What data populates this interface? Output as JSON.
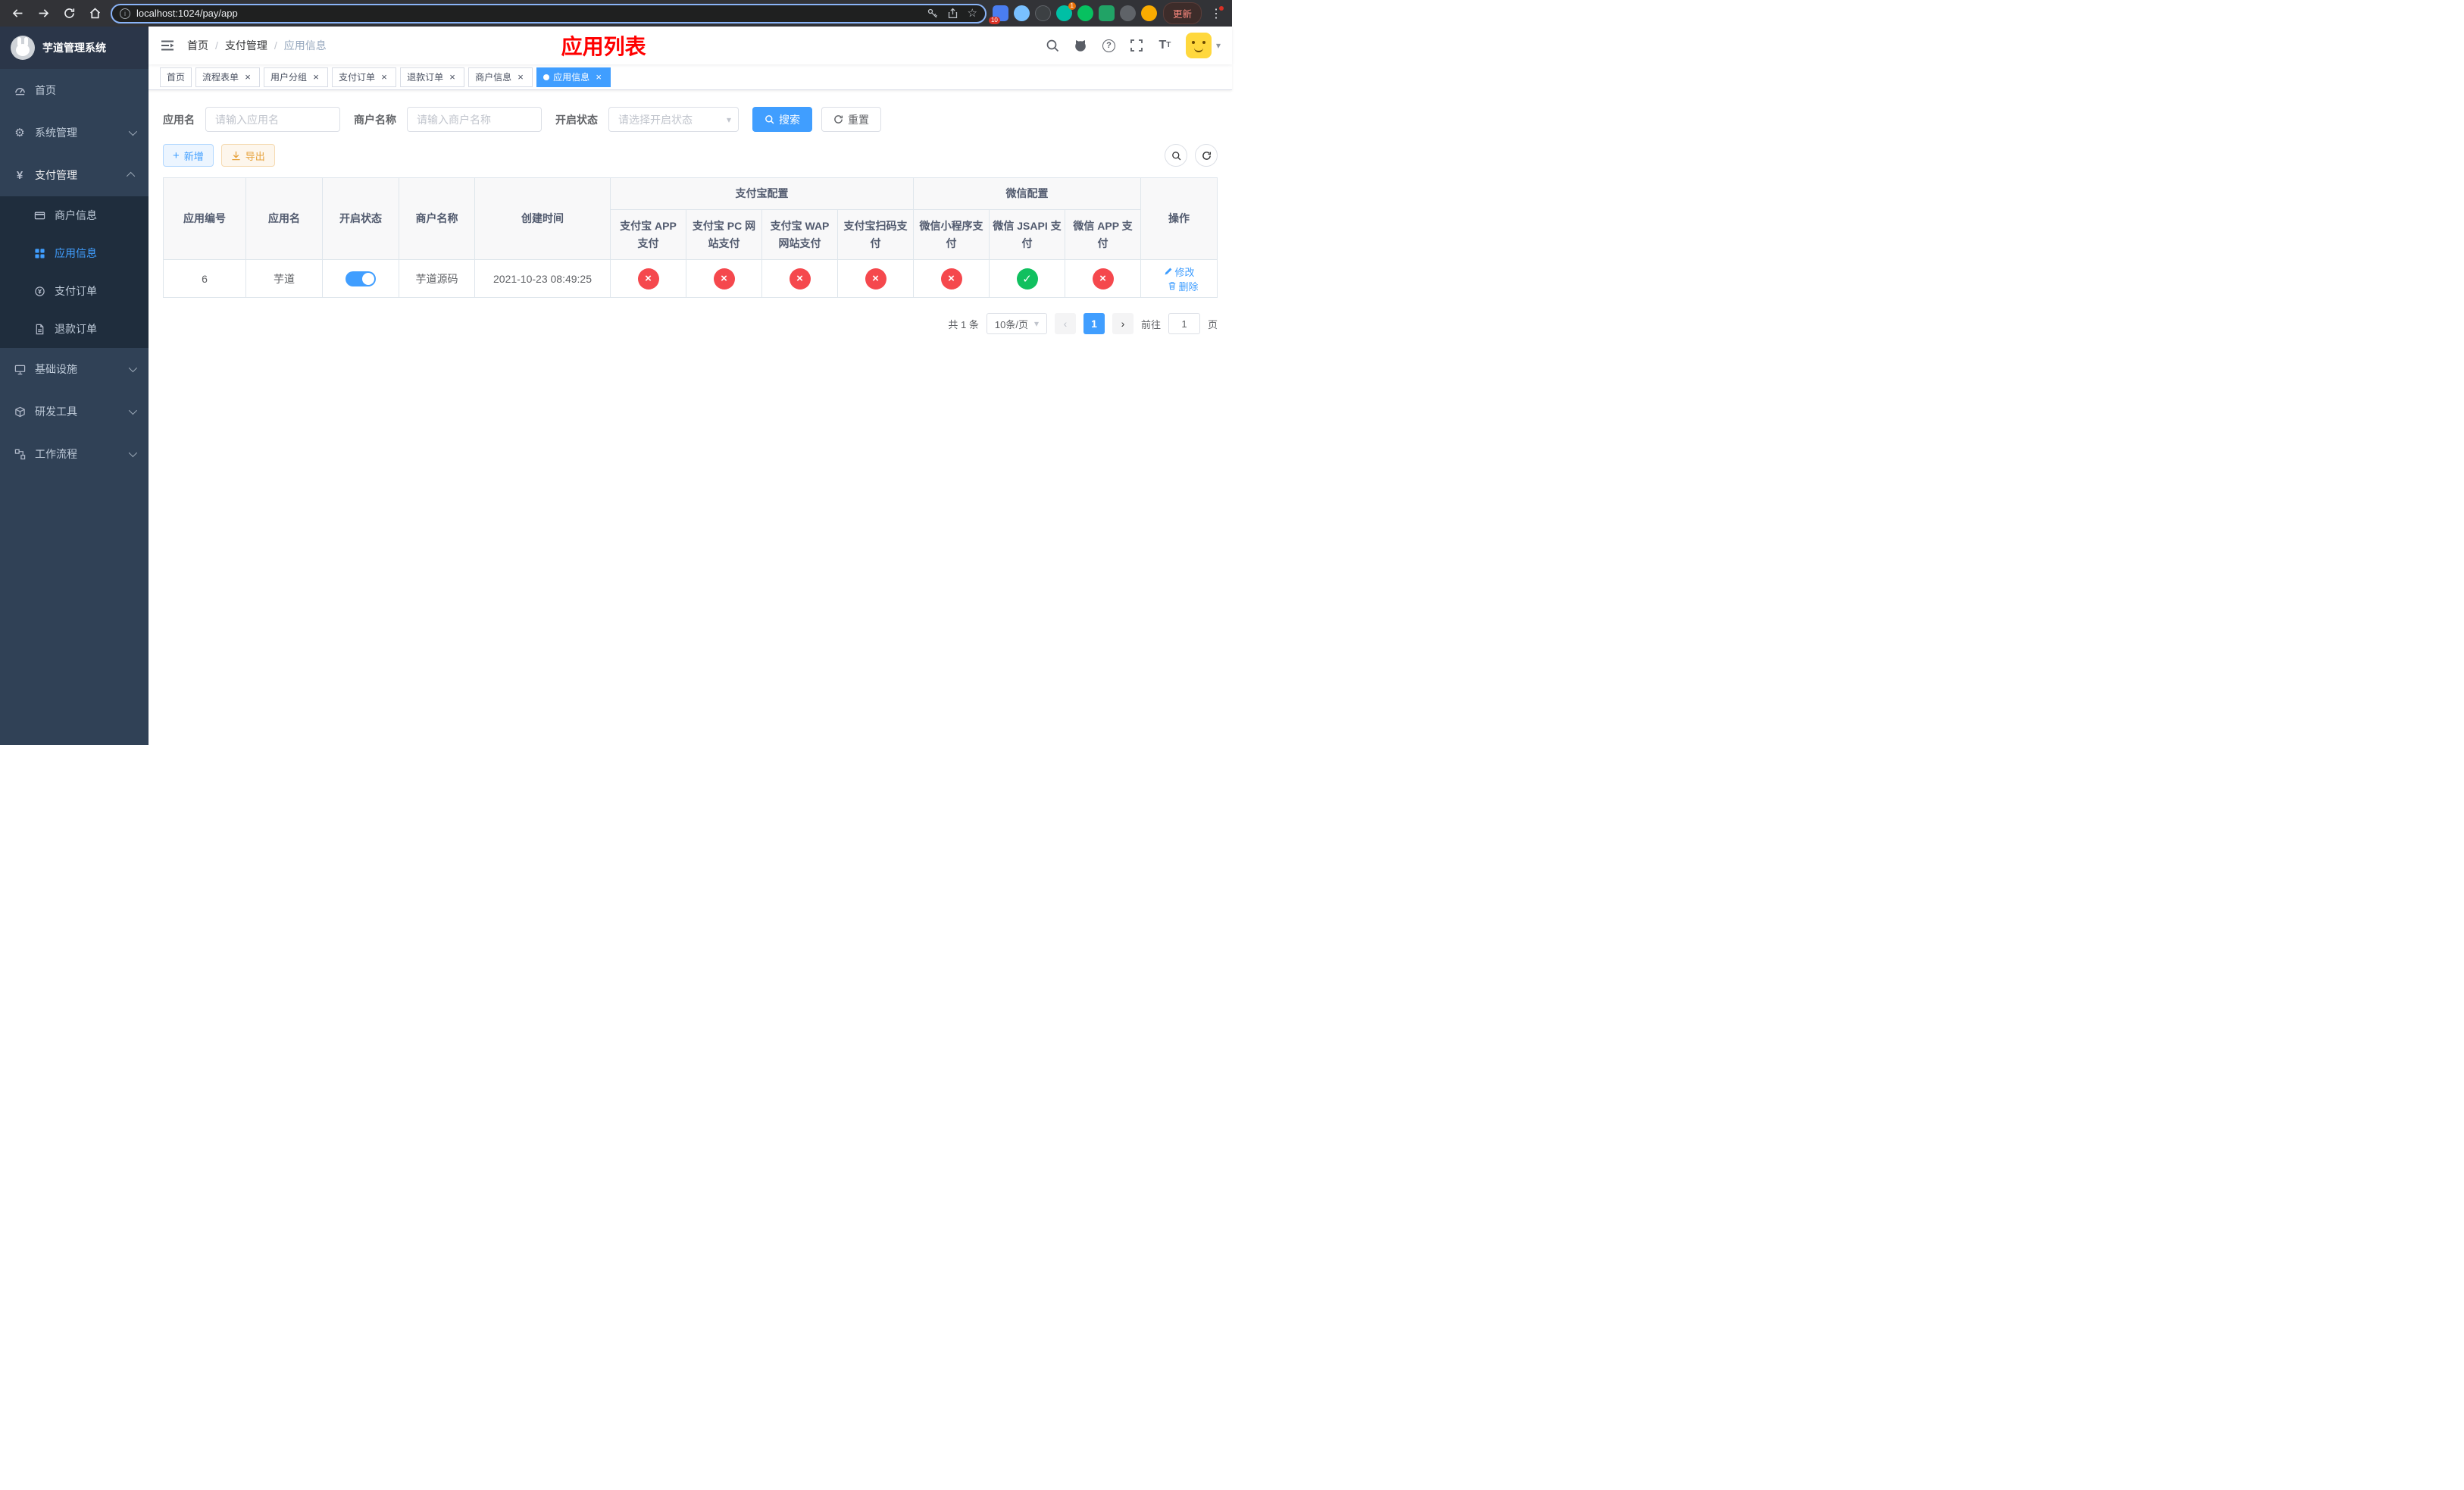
{
  "browser": {
    "url": "localhost:1024/pay/app",
    "update_label": "更新",
    "extensions_badge_1": "10",
    "extensions_badge_2": "1"
  },
  "icons": {
    "gear": "⚙",
    "yen": "¥",
    "star": "☆",
    "menu_dots": "⋮",
    "plus": "+",
    "question": "?",
    "font_size_big": "T",
    "font_size_small": "T",
    "caret_down": "▾",
    "close": "×",
    "check": "✓",
    "cross": "×",
    "prev": "‹",
    "next": "›",
    "info": "i",
    "semantic_names": [
      "back-icon",
      "forward-icon",
      "reload-icon",
      "home-icon",
      "info-icon",
      "key-icon",
      "share-icon",
      "star-icon",
      "search-icon",
      "github-icon",
      "question-icon",
      "fullscreen-icon",
      "font-size-icon",
      "hamburger-icon",
      "chevron-down-icon",
      "chevron-up-icon",
      "dashboard-icon",
      "gear-icon",
      "yen-icon",
      "credit-card-icon",
      "grid-icon",
      "pay-order-icon",
      "refund-doc-icon",
      "monitor-icon",
      "cube-icon",
      "flow-icon",
      "plus-icon",
      "download-icon",
      "refresh-icon",
      "edit-icon",
      "trash-icon",
      "close-icon",
      "check-icon",
      "cross-icon"
    ]
  },
  "sidebar": {
    "app_title": "芋道管理系统",
    "items": [
      {
        "label": "首页"
      },
      {
        "label": "系统管理"
      },
      {
        "label": "支付管理",
        "children": [
          {
            "label": "商户信息"
          },
          {
            "label": "应用信息"
          },
          {
            "label": "支付订单"
          },
          {
            "label": "退款订单"
          }
        ]
      },
      {
        "label": "基础设施"
      },
      {
        "label": "研发工具"
      },
      {
        "label": "工作流程"
      }
    ]
  },
  "header": {
    "breadcrumb": {
      "home": "首页",
      "section": "支付管理",
      "current": "应用信息",
      "separator": "/"
    },
    "page_title": "应用列表"
  },
  "tabs": [
    {
      "label": "首页",
      "closable": false,
      "active": false
    },
    {
      "label": "流程表单",
      "closable": true,
      "active": false
    },
    {
      "label": "用户分组",
      "closable": true,
      "active": false
    },
    {
      "label": "支付订单",
      "closable": true,
      "active": false
    },
    {
      "label": "退款订单",
      "closable": true,
      "active": false
    },
    {
      "label": "商户信息",
      "closable": true,
      "active": false
    },
    {
      "label": "应用信息",
      "closable": true,
      "active": true
    }
  ],
  "filter": {
    "app_name_label": "应用名",
    "app_name_placeholder": "请输入应用名",
    "merchant_label": "商户名称",
    "merchant_placeholder": "请输入商户名称",
    "status_label": "开启状态",
    "status_placeholder": "请选择开启状态",
    "search_label": "搜索",
    "reset_label": "重置"
  },
  "toolbar": {
    "add_label": "新增",
    "export_label": "导出"
  },
  "table": {
    "group_headers": {
      "alipay": "支付宝配置",
      "wechat": "微信配置"
    },
    "columns": [
      "应用编号",
      "应用名",
      "开启状态",
      "商户名称",
      "创建时间",
      "支付宝 APP 支付",
      "支付宝 PC 网站支付",
      "支付宝 WAP 网站支付",
      "支付宝扫码支付",
      "微信小程序支付",
      "微信 JSAPI 支付",
      "微信 APP 支付",
      "操作"
    ],
    "rows": [
      {
        "id": "6",
        "name": "芋道",
        "enabled": true,
        "merchant": "芋道源码",
        "created": "2021-10-23 08:49:25",
        "configs": [
          "fail",
          "fail",
          "fail",
          "fail",
          "fail",
          "ok",
          "fail"
        ],
        "edit_label": "修改",
        "delete_label": "删除"
      }
    ]
  },
  "pagination": {
    "total": "共 1 条",
    "page_size": "10条/页",
    "current_page": "1",
    "goto_prefix": "前往",
    "goto_value": "1",
    "goto_suffix": "页"
  },
  "colors": {
    "accent": "#409eff",
    "sidebar_bg": "#304156",
    "submenu_bg": "#1f2d3d",
    "danger_circle": "#f5484d",
    "success_circle": "#10c05f",
    "title_red": "#ff0000",
    "warning": "#e6a23c"
  }
}
